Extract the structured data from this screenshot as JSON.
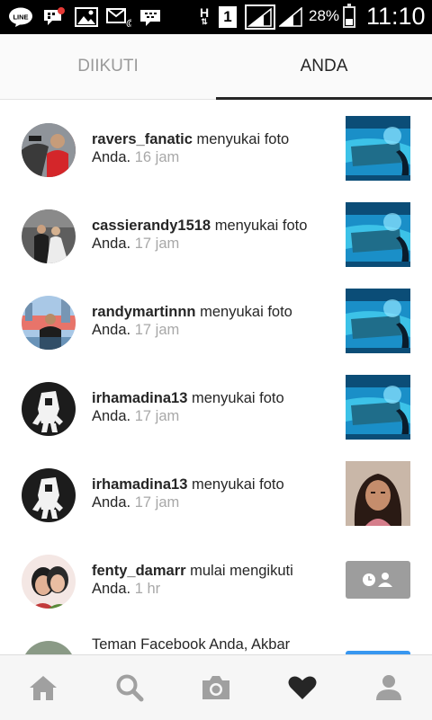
{
  "status_bar": {
    "battery_percent": "28%",
    "time": "11:10",
    "sim_label": "1",
    "network_label": "H"
  },
  "tabs": {
    "following": "DIIKUTI",
    "you": "ANDA"
  },
  "notifications": [
    {
      "username": "ravers_fanatic",
      "action": " menyukai foto",
      "object": "Anda.",
      "time": "16 jam"
    },
    {
      "username": "cassierandy1518",
      "action": " menyukai foto",
      "object": "Anda.",
      "time": "17 jam"
    },
    {
      "username": "randymartinnn",
      "action": " menyukai foto",
      "object": "Anda.",
      "time": "17 jam"
    },
    {
      "username": "irhamadina13",
      "action": " menyukai foto",
      "object": "Anda.",
      "time": "17 jam"
    },
    {
      "username": "irhamadina13",
      "action": " menyukai foto",
      "object": "Anda.",
      "time": "17 jam"
    },
    {
      "username": "fenty_damarr",
      "action": " mulai mengikuti",
      "object": "Anda.",
      "time": "1 hr"
    }
  ],
  "facebook_notice": {
    "text": "Teman Facebook Anda, Akbar"
  },
  "icons": {
    "nav": [
      "home-icon",
      "search-icon",
      "camera-icon",
      "heart-icon",
      "profile-icon"
    ],
    "status": [
      "line-icon",
      "chat-icon",
      "image-icon",
      "missed-call-icon",
      "bbm-icon",
      "signal-icon",
      "battery-icon"
    ]
  },
  "colors": {
    "active_text": "#262626",
    "inactive_text": "#9a9a9a",
    "time_text": "#a8a8a8",
    "nav_icon": "#a0a0a0",
    "nav_active": "#262626"
  }
}
